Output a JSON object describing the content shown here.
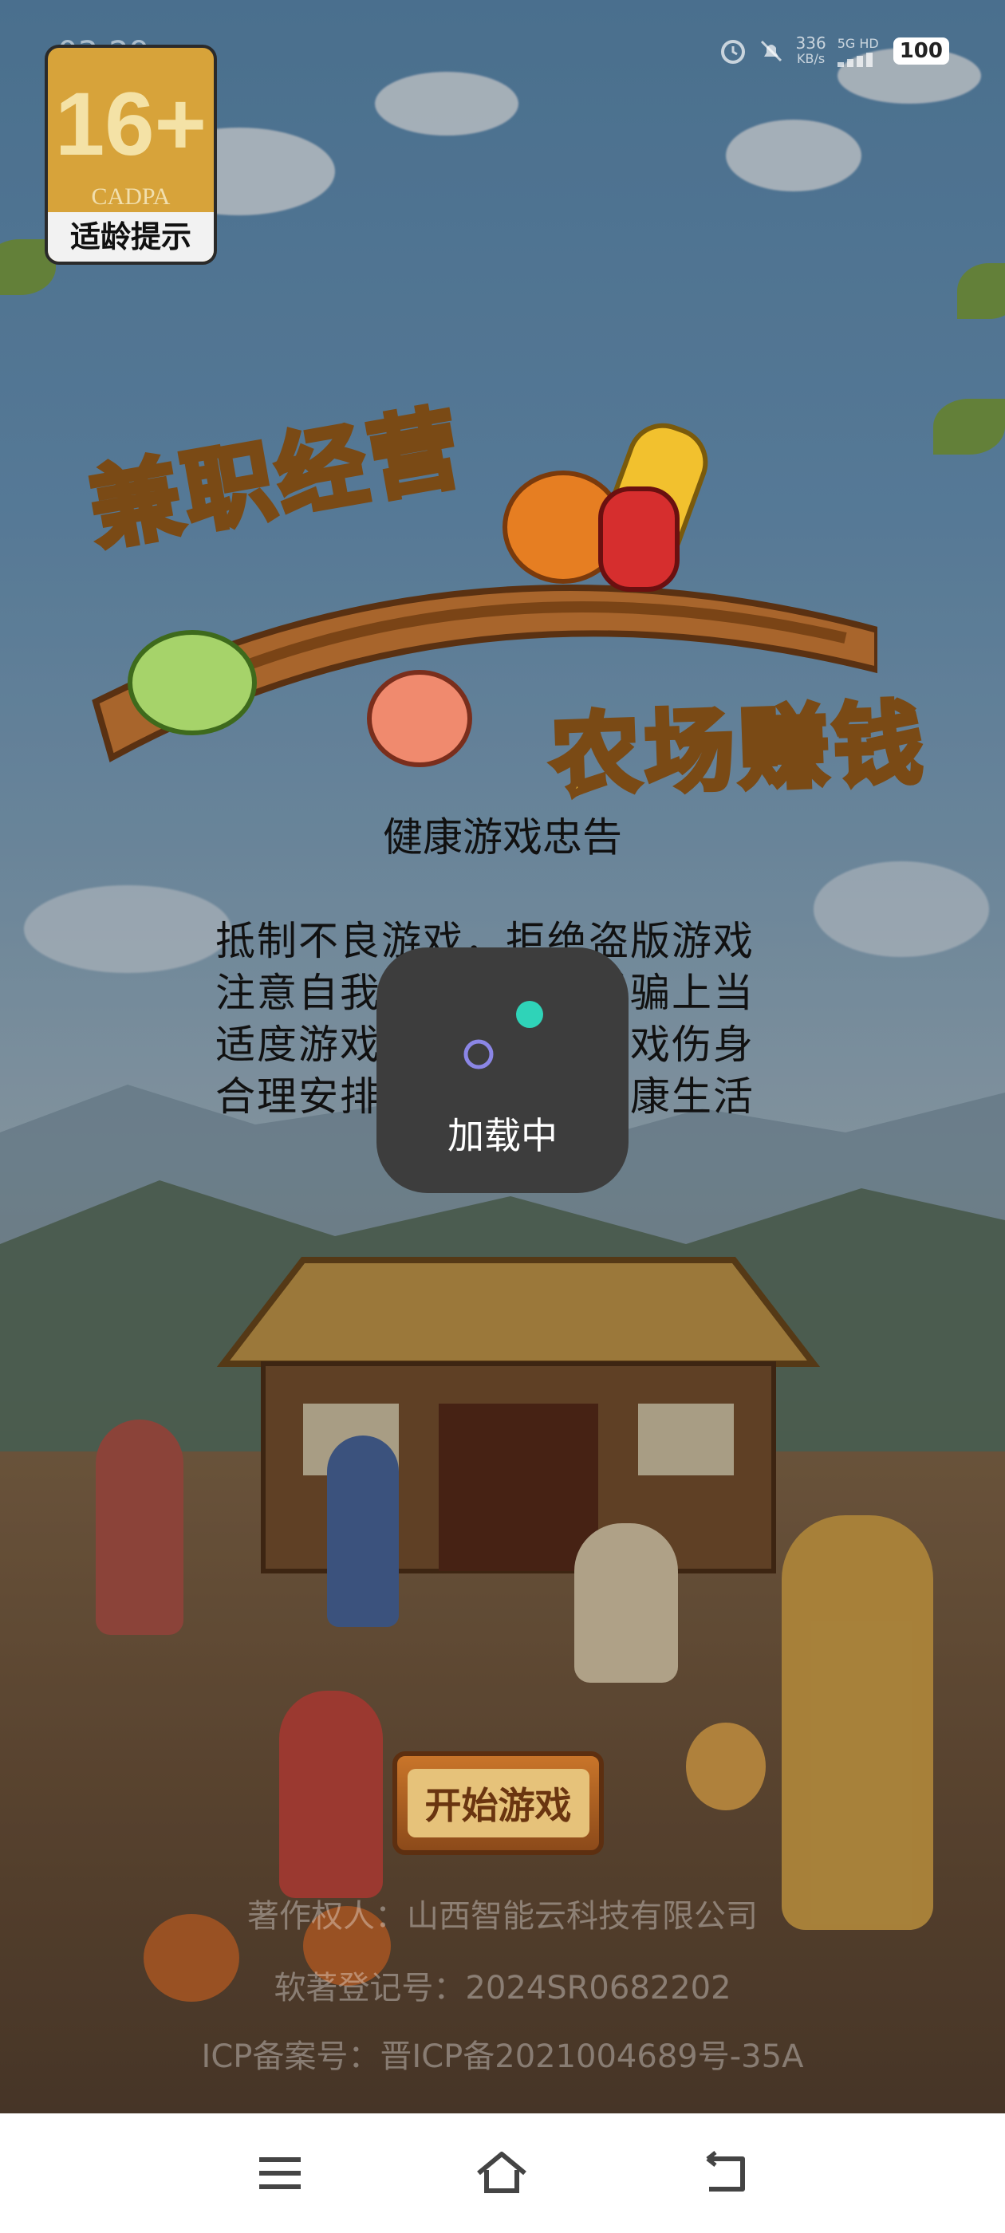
{
  "status_bar": {
    "time": "03:29",
    "speed_value": "336",
    "speed_unit": "KB/s",
    "network": "5G HD",
    "battery": "100"
  },
  "age_rating": {
    "rating": "16+",
    "org": "CADPA",
    "label": "适龄提示"
  },
  "logo": {
    "line1": "兼职经营",
    "line2": "农场赚钱"
  },
  "health_notice": {
    "title": "健康游戏忠告",
    "lines": [
      "抵制不良游戏，拒绝盗版游戏",
      "注意自我保护，谨防受骗上当",
      "适度游戏益脑，沉迷游戏伤身",
      "合理安排时间，享受健康生活"
    ]
  },
  "start_button": {
    "label": "开始游戏"
  },
  "credits": {
    "copyright": "著作权人：山西智能云科技有限公司",
    "software_reg": "软著登记号：2024SR0682202",
    "icp": "ICP备案号：晋ICP备2021004689号-35A"
  },
  "loading": {
    "label": "加载中",
    "dot_color": "#2fd3b8",
    "ring_color": "#8b86e6"
  }
}
